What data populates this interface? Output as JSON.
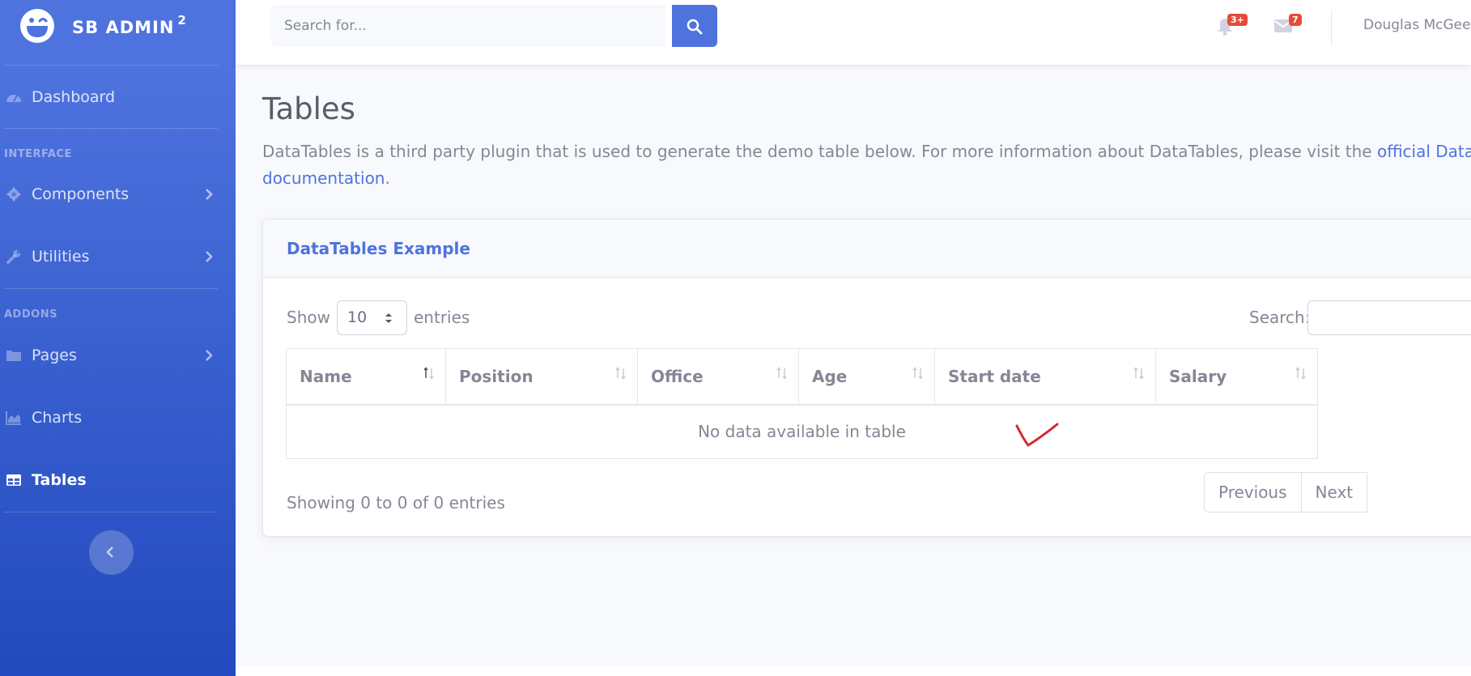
{
  "brand": {
    "name": "SB ADMIN",
    "superscript": "2"
  },
  "sidebar": {
    "dashboard": "Dashboard",
    "heading_interface": "INTERFACE",
    "components": "Components",
    "utilities": "Utilities",
    "heading_addons": "ADDONS",
    "pages": "Pages",
    "charts": "Charts",
    "tables": "Tables"
  },
  "topbar": {
    "search_placeholder": "Search for...",
    "alerts_badge": "3+",
    "messages_badge": "7",
    "user_name": "Douglas McGee"
  },
  "page": {
    "title": "Tables",
    "description": "DataTables is a third party plugin that is used to generate the demo table below. For more information about DataTables, please visit the ",
    "link_text": "official DataTables documentation",
    "description_end": "."
  },
  "card": {
    "title": "DataTables Example",
    "show_label": "Show",
    "length_value": "10",
    "entries_label": "entries",
    "search_label": "Search:",
    "columns": [
      "Name",
      "Position",
      "Office",
      "Age",
      "Start date",
      "Salary"
    ],
    "empty_message": "No data available in table",
    "info": "Showing 0 to 0 of 0 entries",
    "prev_label": "Previous",
    "next_label": "Next"
  },
  "colors": {
    "primary": "#4e73df",
    "sidebar_gradient_end": "#224abe",
    "badge": "#e74a3b",
    "annotation": "#d9262c"
  }
}
